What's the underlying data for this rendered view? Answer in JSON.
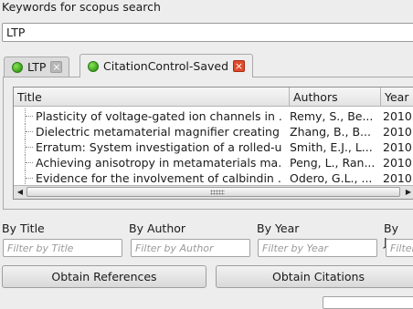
{
  "keywords": {
    "label": "Keywords for scopus search",
    "value": "LTP"
  },
  "tabs": [
    {
      "label": "LTP",
      "close": "×"
    },
    {
      "label": "CitationControl-Saved",
      "close": "×"
    }
  ],
  "table": {
    "headers": [
      "Title",
      "Authors",
      "Year"
    ],
    "rows": [
      {
        "title": "Plasticity of voltage-gated ion channels in ...",
        "authors": "Remy, S., Be...",
        "year": "2010"
      },
      {
        "title": "Dielectric metamaterial magnifier creating ...",
        "authors": "Zhang, B., B...",
        "year": "2010"
      },
      {
        "title": "Erratum: System investigation of a rolled-u...",
        "authors": "Smith, E.J., L...",
        "year": "2010"
      },
      {
        "title": "Achieving anisotropy in metamaterials ma...",
        "authors": "Peng, L., Ran...",
        "year": "2010"
      },
      {
        "title": "Evidence for the involvement of calbindin ...",
        "authors": "Odero, G.L., ...",
        "year": "2010"
      }
    ]
  },
  "filters": [
    {
      "label": "By Title",
      "placeholder": "Filter by Title"
    },
    {
      "label": "By Author",
      "placeholder": "Filter by Author"
    },
    {
      "label": "By Year",
      "placeholder": "Filter by Year"
    },
    {
      "label": "By Jou",
      "placeholder": "Filter"
    }
  ],
  "buttons": {
    "obtain_references": "Obtain References",
    "obtain_citations": "Obtain Citations"
  }
}
